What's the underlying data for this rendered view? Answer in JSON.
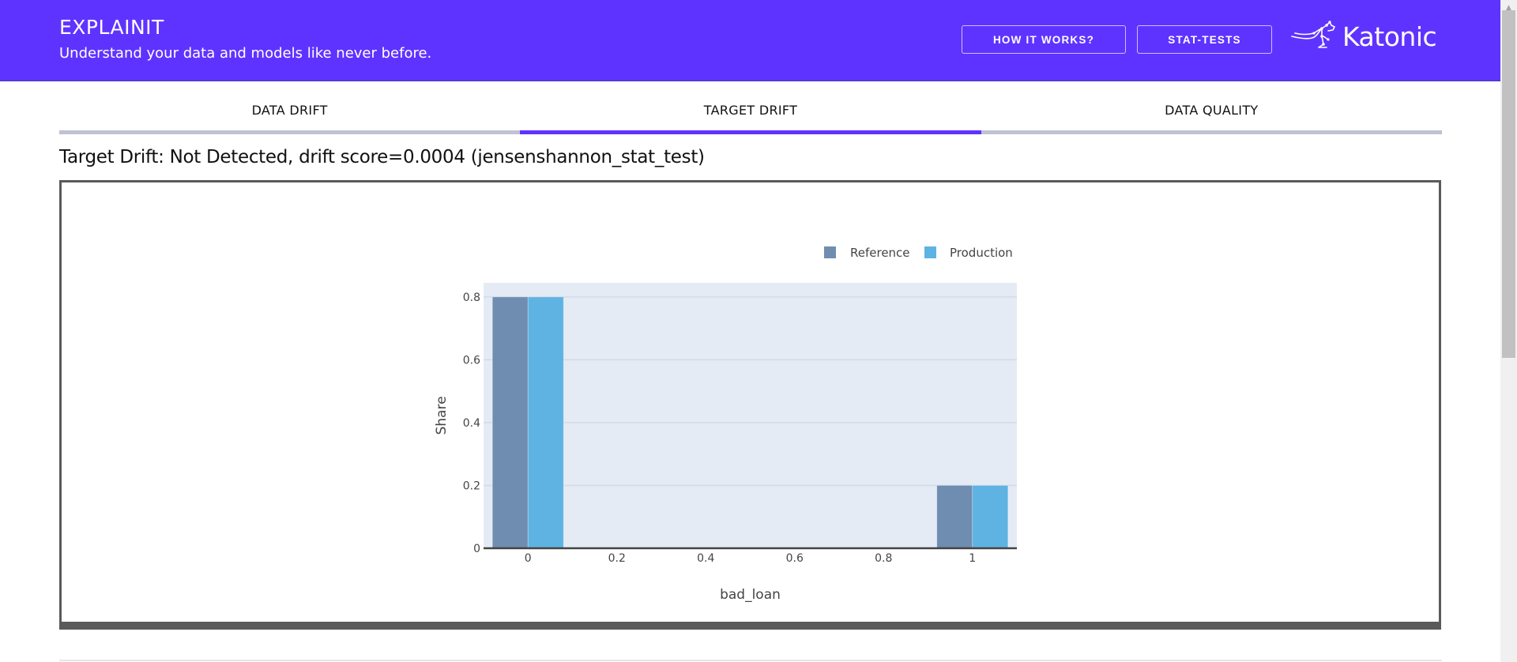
{
  "header": {
    "title": "EXPLAINIT",
    "subtitle": "Understand your data and models like never before.",
    "buttons": [
      {
        "label": "HOW IT WORKS?"
      },
      {
        "label": "STAT-TESTS"
      }
    ],
    "logo_text": "Katonic",
    "logo_icon": "kangaroo-icon",
    "background_color": "#5f33ff"
  },
  "tabs": [
    {
      "label": "DATA DRIFT",
      "active": false
    },
    {
      "label": "TARGET DRIFT",
      "active": true
    },
    {
      "label": "DATA QUALITY",
      "active": false
    }
  ],
  "status": {
    "text": "Target Drift: Not Detected, drift score=0.0004 (jensenshannon_stat_test)"
  },
  "chart_data": {
    "type": "bar",
    "title": "",
    "xlabel": "bad_loan",
    "ylabel": "Share",
    "x": [
      0,
      1
    ],
    "xticks": [
      "0",
      "0.2",
      "0.4",
      "0.6",
      "0.8",
      "1"
    ],
    "yticks": [
      "0",
      "0.2",
      "0.4",
      "0.6",
      "0.8"
    ],
    "xlim": [
      -0.1,
      1.1
    ],
    "ylim": [
      0,
      0.845
    ],
    "grid": true,
    "legend": "top-right",
    "series": [
      {
        "name": "Reference",
        "values": [
          0.8,
          0.2
        ],
        "color": "#6f8db0"
      },
      {
        "name": "Production",
        "values": [
          0.8,
          0.2
        ],
        "color": "#5eb3e2"
      }
    ]
  },
  "scrollbar": {
    "up_icon": "scroll-up-arrow-icon",
    "position": 0
  }
}
